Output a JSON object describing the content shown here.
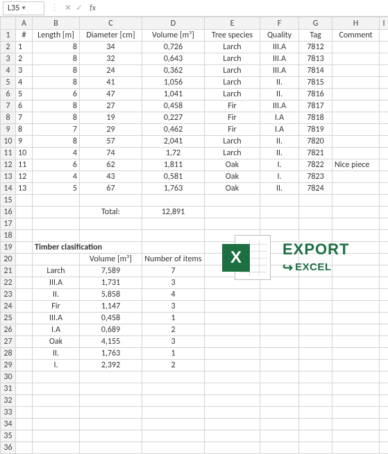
{
  "namebox": "L35",
  "fx_label": "fx",
  "col_headers": [
    "A",
    "B",
    "C",
    "D",
    "E",
    "F",
    "G",
    "H",
    "I"
  ],
  "headers": {
    "num": "#",
    "length": "Length [m]",
    "diameter": "Diameter [cm]",
    "volume": "Volume [m³]",
    "species": "Tree species",
    "quality": "Quality",
    "tag": "Tag",
    "comment": "Comment"
  },
  "rows": [
    {
      "n": "1",
      "len": "8",
      "dia": "34",
      "vol": "0,726",
      "sp": "Larch",
      "q": "III.A",
      "tag": "7812",
      "c": ""
    },
    {
      "n": "2",
      "len": "8",
      "dia": "32",
      "vol": "0,643",
      "sp": "Larch",
      "q": "III.A",
      "tag": "7813",
      "c": ""
    },
    {
      "n": "3",
      "len": "8",
      "dia": "24",
      "vol": "0,362",
      "sp": "Larch",
      "q": "III.A",
      "tag": "7814",
      "c": ""
    },
    {
      "n": "4",
      "len": "8",
      "dia": "41",
      "vol": "1,056",
      "sp": "Larch",
      "q": "II.",
      "tag": "7815",
      "c": ""
    },
    {
      "n": "5",
      "len": "6",
      "dia": "47",
      "vol": "1,041",
      "sp": "Larch",
      "q": "II.",
      "tag": "7816",
      "c": ""
    },
    {
      "n": "6",
      "len": "8",
      "dia": "27",
      "vol": "0,458",
      "sp": "Fir",
      "q": "III.A",
      "tag": "7817",
      "c": ""
    },
    {
      "n": "7",
      "len": "8",
      "dia": "19",
      "vol": "0,227",
      "sp": "Fir",
      "q": "I.A",
      "tag": "7818",
      "c": ""
    },
    {
      "n": "8",
      "len": "7",
      "dia": "29",
      "vol": "0,462",
      "sp": "Fir",
      "q": "I.A",
      "tag": "7819",
      "c": ""
    },
    {
      "n": "9",
      "len": "8",
      "dia": "57",
      "vol": "2,041",
      "sp": "Larch",
      "q": "II.",
      "tag": "7820",
      "c": ""
    },
    {
      "n": "10",
      "len": "4",
      "dia": "74",
      "vol": "1,72",
      "sp": "Larch",
      "q": "II.",
      "tag": "7821",
      "c": ""
    },
    {
      "n": "11",
      "len": "6",
      "dia": "62",
      "vol": "1,811",
      "sp": "Oak",
      "q": "I.",
      "tag": "7822",
      "c": "Nice piece"
    },
    {
      "n": "12",
      "len": "4",
      "dia": "43",
      "vol": "0,581",
      "sp": "Oak",
      "q": "I.",
      "tag": "7823",
      "c": ""
    },
    {
      "n": "13",
      "len": "5",
      "dia": "67",
      "vol": "1,763",
      "sp": "Oak",
      "q": "II.",
      "tag": "7824",
      "c": ""
    }
  ],
  "total_label": "Total:",
  "total_value": "12,891",
  "classification_title": "Timber clasification",
  "class_headers": {
    "vol": "Volume [m³]",
    "num": "Number of items"
  },
  "class_rows": [
    {
      "name": "Larch",
      "vol": "7,589",
      "num": "7"
    },
    {
      "name": "III.A",
      "vol": "1,731",
      "num": "3"
    },
    {
      "name": "II.",
      "vol": "5,858",
      "num": "4"
    },
    {
      "name": "Fir",
      "vol": "1,147",
      "num": "3"
    },
    {
      "name": "III.A",
      "vol": "0,458",
      "num": "1"
    },
    {
      "name": "I.A",
      "vol": "0,689",
      "num": "2"
    },
    {
      "name": "Oak",
      "vol": "4,155",
      "num": "3"
    },
    {
      "name": "II.",
      "vol": "1,763",
      "num": "1"
    },
    {
      "name": "I.",
      "vol": "2,392",
      "num": "2"
    }
  ],
  "graphic": {
    "x": "X",
    "title": "EXPORT",
    "arrow": "↪",
    "word": "EXCEL"
  }
}
